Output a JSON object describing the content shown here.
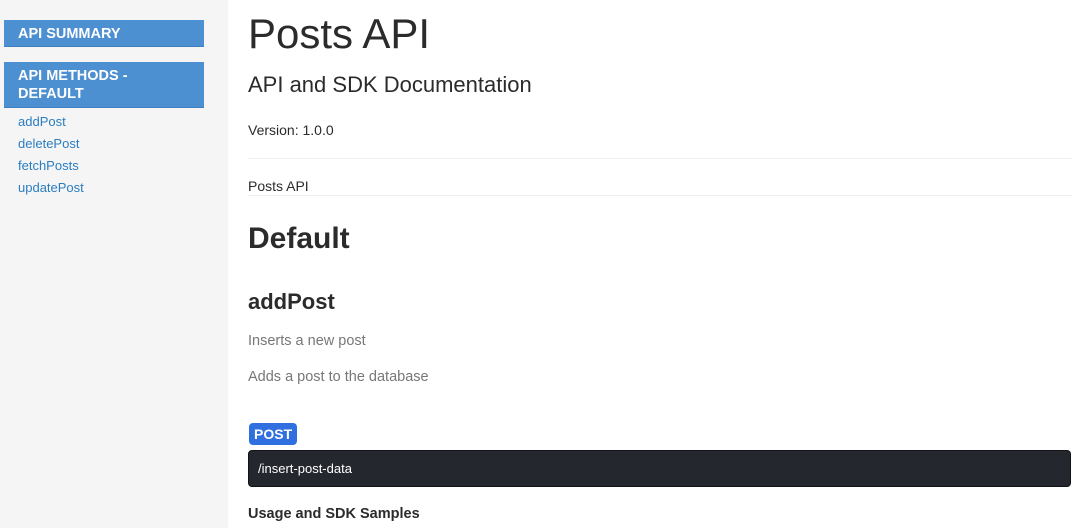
{
  "sidebar": {
    "summary_header": "API SUMMARY",
    "methods_header": "API METHODS - DEFAULT",
    "methods": [
      "addPost",
      "deletePost",
      "fetchPosts",
      "updatePost"
    ]
  },
  "main": {
    "title": "Posts API",
    "subtitle": "API and SDK Documentation",
    "version": "Version: 1.0.0",
    "description": "Posts API",
    "section_heading": "Default",
    "method": {
      "name": "addPost",
      "summary": "Inserts a new post",
      "notes": "Adds a post to the database",
      "http_method": "POST",
      "path": "/insert-post-data",
      "usage_heading": "Usage and SDK Samples"
    }
  },
  "colors": {
    "sidebar_bg": "#f5f5f5",
    "nav_header_bg": "#4d90d1",
    "link": "#2a7dc2",
    "badge_post": "#2f6fe0",
    "code_bg": "#24272e"
  }
}
